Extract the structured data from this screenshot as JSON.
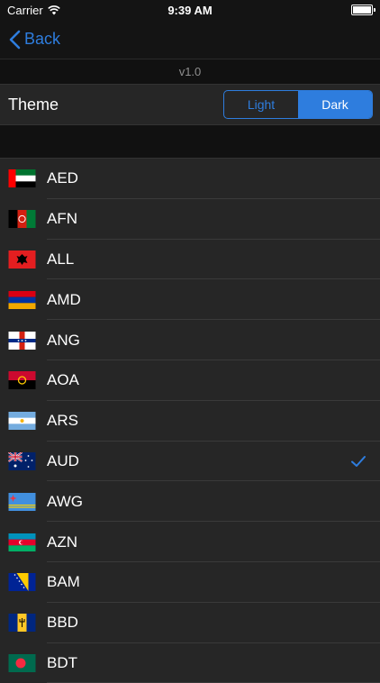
{
  "status": {
    "carrier": "Carrier",
    "time": "9:39 AM"
  },
  "nav": {
    "back_label": "Back"
  },
  "version": "v1.0",
  "theme": {
    "label": "Theme",
    "options": [
      "Light",
      "Dark"
    ],
    "selected": "Dark"
  },
  "accent_color": "#2e7dde",
  "currencies": [
    {
      "code": "AED",
      "flag": "uae-flag-icon"
    },
    {
      "code": "AFN",
      "flag": "afghanistan-flag-icon"
    },
    {
      "code": "ALL",
      "flag": "albania-flag-icon"
    },
    {
      "code": "AMD",
      "flag": "armenia-flag-icon"
    },
    {
      "code": "ANG",
      "flag": "netherlands-antilles-flag-icon"
    },
    {
      "code": "AOA",
      "flag": "angola-flag-icon"
    },
    {
      "code": "ARS",
      "flag": "argentina-flag-icon"
    },
    {
      "code": "AUD",
      "flag": "australia-flag-icon",
      "selected": true
    },
    {
      "code": "AWG",
      "flag": "aruba-flag-icon"
    },
    {
      "code": "AZN",
      "flag": "azerbaijan-flag-icon"
    },
    {
      "code": "BAM",
      "flag": "bosnia-flag-icon"
    },
    {
      "code": "BBD",
      "flag": "barbados-flag-icon"
    },
    {
      "code": "BDT",
      "flag": "bangladesh-flag-icon"
    }
  ]
}
